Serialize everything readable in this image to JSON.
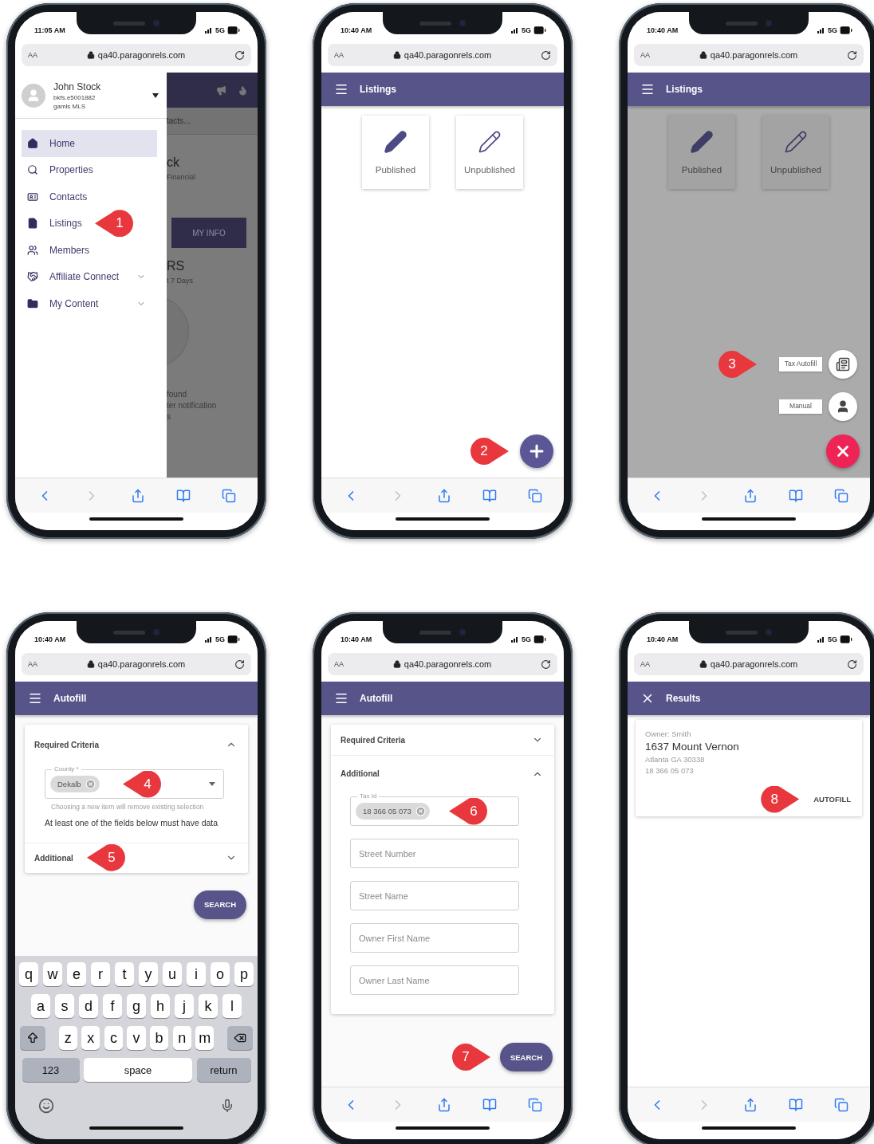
{
  "phones": [
    {
      "kind": "menu",
      "time": "11:05 AM",
      "network": "5G",
      "text_size": "AA",
      "url": "qa40.paragonrels.com",
      "back_enabled": true,
      "forward_enabled": false,
      "profile": {
        "name": "John Stock",
        "user_id": "bkfs.e5001882",
        "mls": "gamls MLS"
      },
      "menu": [
        {
          "label": "Home",
          "selected": true,
          "expandable": false
        },
        {
          "label": "Properties",
          "selected": false,
          "expandable": false
        },
        {
          "label": "Contacts",
          "selected": false,
          "expandable": false
        },
        {
          "label": "Listings",
          "selected": false,
          "expandable": false,
          "callout": {
            "number": "1",
            "points_right": false
          }
        },
        {
          "label": "Members",
          "selected": false,
          "expandable": false
        },
        {
          "label": "Affiliate Connect",
          "selected": false,
          "expandable": true
        },
        {
          "label": "My Content",
          "selected": false,
          "expandable": true
        }
      ],
      "background": {
        "search_hint": "tacts...",
        "name_fragment": "ck",
        "company_fragment": "Financial",
        "button": "MY INFO",
        "heading_fragment": "RS",
        "period_fragment": "t 7 Days",
        "notes": [
          "found",
          "ter notification",
          "s"
        ]
      }
    },
    {
      "kind": "listings",
      "time": "10:40 AM",
      "network": "5G",
      "text_size": "AA",
      "url": "qa40.paragonrels.com",
      "back_enabled": true,
      "forward_enabled": false,
      "close_button": false,
      "title": "Listings",
      "tiles": [
        {
          "label": "Published",
          "kind": "filled"
        },
        {
          "label": "Unpublished",
          "kind": "outline"
        }
      ],
      "fab_open": false,
      "fab_callout": {
        "number": "2",
        "points_right": true
      }
    },
    {
      "kind": "listings",
      "time": "10:40 AM",
      "network": "5G",
      "text_size": "AA",
      "url": "qa40.paragonrels.com",
      "back_enabled": true,
      "forward_enabled": false,
      "close_button": false,
      "title": "Listings",
      "tiles": [
        {
          "label": "Published",
          "kind": "filled"
        },
        {
          "label": "Unpublished",
          "kind": "outline"
        }
      ],
      "fab_open": true,
      "actions": [
        {
          "label": "Tax Autofill",
          "kind": "tax",
          "callout": {
            "number": "3",
            "points_right": true
          }
        },
        {
          "label": "Manual",
          "kind": "manual"
        }
      ]
    },
    {
      "kind": "autofill",
      "time": "10:40 AM",
      "network": "5G",
      "text_size": "AA",
      "url": "qa40.paragonrels.com",
      "close_button": false,
      "title": "Autofill",
      "sections": [
        {
          "title": "Required Criteria",
          "expanded": true,
          "fields": [
            {
              "kind": "select",
              "label": "County *",
              "value": "Dekalb",
              "helper": "Choosing a new item will remove existing selection",
              "callout": {
                "number": "4",
                "points_right": false
              }
            }
          ],
          "note": "At least one of the fields below must have data"
        },
        {
          "title": "Additional",
          "expanded": false,
          "callout": {
            "number": "5",
            "points_right": false
          }
        }
      ],
      "search": {
        "label": "SEARCH"
      },
      "keyboard": {
        "rows": [
          [
            "q",
            "w",
            "e",
            "r",
            "t",
            "y",
            "u",
            "i",
            "o",
            "p"
          ],
          [
            "a",
            "s",
            "d",
            "f",
            "g",
            "h",
            "j",
            "k",
            "l"
          ],
          [
            "z",
            "x",
            "c",
            "v",
            "b",
            "n",
            "m"
          ]
        ],
        "numbers_key": "123",
        "space_key": "space",
        "return_key": "return"
      }
    },
    {
      "kind": "autofill",
      "time": "10:40 AM",
      "network": "5G",
      "text_size": "AA",
      "url": "qa40.paragonrels.com",
      "back_enabled": true,
      "forward_enabled": false,
      "close_button": false,
      "title": "Autofill",
      "sections": [
        {
          "title": "Required Criteria",
          "expanded": false
        },
        {
          "title": "Additional",
          "expanded": true,
          "fields": [
            {
              "kind": "chips",
              "label": "Tax Id",
              "value": "18 366 05 073",
              "callout": {
                "number": "6",
                "points_right": false
              }
            },
            {
              "kind": "text",
              "placeholder": "Street Number"
            },
            {
              "kind": "text",
              "placeholder": "Street Name"
            },
            {
              "kind": "text",
              "placeholder": "Owner First Name"
            },
            {
              "kind": "text",
              "placeholder": "Owner Last Name"
            }
          ]
        }
      ],
      "search": {
        "label": "SEARCH",
        "callout": {
          "number": "7",
          "points_right": true
        }
      }
    },
    {
      "kind": "results",
      "time": "10:40 AM",
      "network": "5G",
      "text_size": "AA",
      "url": "qa40.paragonrels.com",
      "back_enabled": true,
      "forward_enabled": false,
      "close_button": true,
      "title": "Results",
      "results": [
        {
          "owner": "Owner: Smith",
          "address": "1637 Mount Vernon",
          "city": "Atlanta GA 30338",
          "tax_id": "18 366 05 073",
          "action": "AUTOFILL",
          "callout": {
            "number": "8",
            "points_right": true
          }
        }
      ]
    }
  ]
}
